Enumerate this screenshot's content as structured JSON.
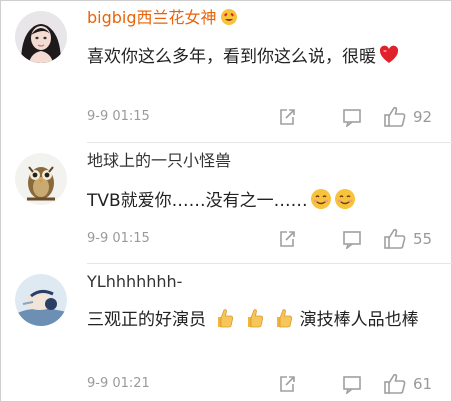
{
  "comments": [
    {
      "username": "bigbig西兰花女神",
      "text": "喜欢你这么多年，看到你这么说，很暖",
      "time": "9-9 01:15",
      "likes": "92",
      "badge_icon": "heart-eyes-emoji-icon",
      "inline_icons": [
        "red-heart-icon"
      ]
    },
    {
      "username": "地球上的一只小怪兽",
      "text_main": "TVB就爱你……没有之一……",
      "time": "9-9 01:15",
      "likes": "55",
      "inline_icons": [
        "smile-emoji-icon",
        "smile-emoji-icon"
      ]
    },
    {
      "username": "YLhhhhhhh-",
      "text_part1": "三观正的好演员",
      "text_part2": "演技棒人品也棒",
      "time": "9-9 01:21",
      "likes": "61",
      "inline_icons": [
        "thumbs-up-emoji-icon",
        "thumbs-up-emoji-icon",
        "thumbs-up-emoji-icon"
      ]
    }
  ],
  "icons": {
    "repost": "repost-icon",
    "reply": "comment-icon",
    "like": "like-thumb-icon"
  },
  "colors": {
    "highlight_username": "#e8630a",
    "username": "#333333",
    "meta": "#9a9a9a",
    "heart": "#e0202a"
  }
}
